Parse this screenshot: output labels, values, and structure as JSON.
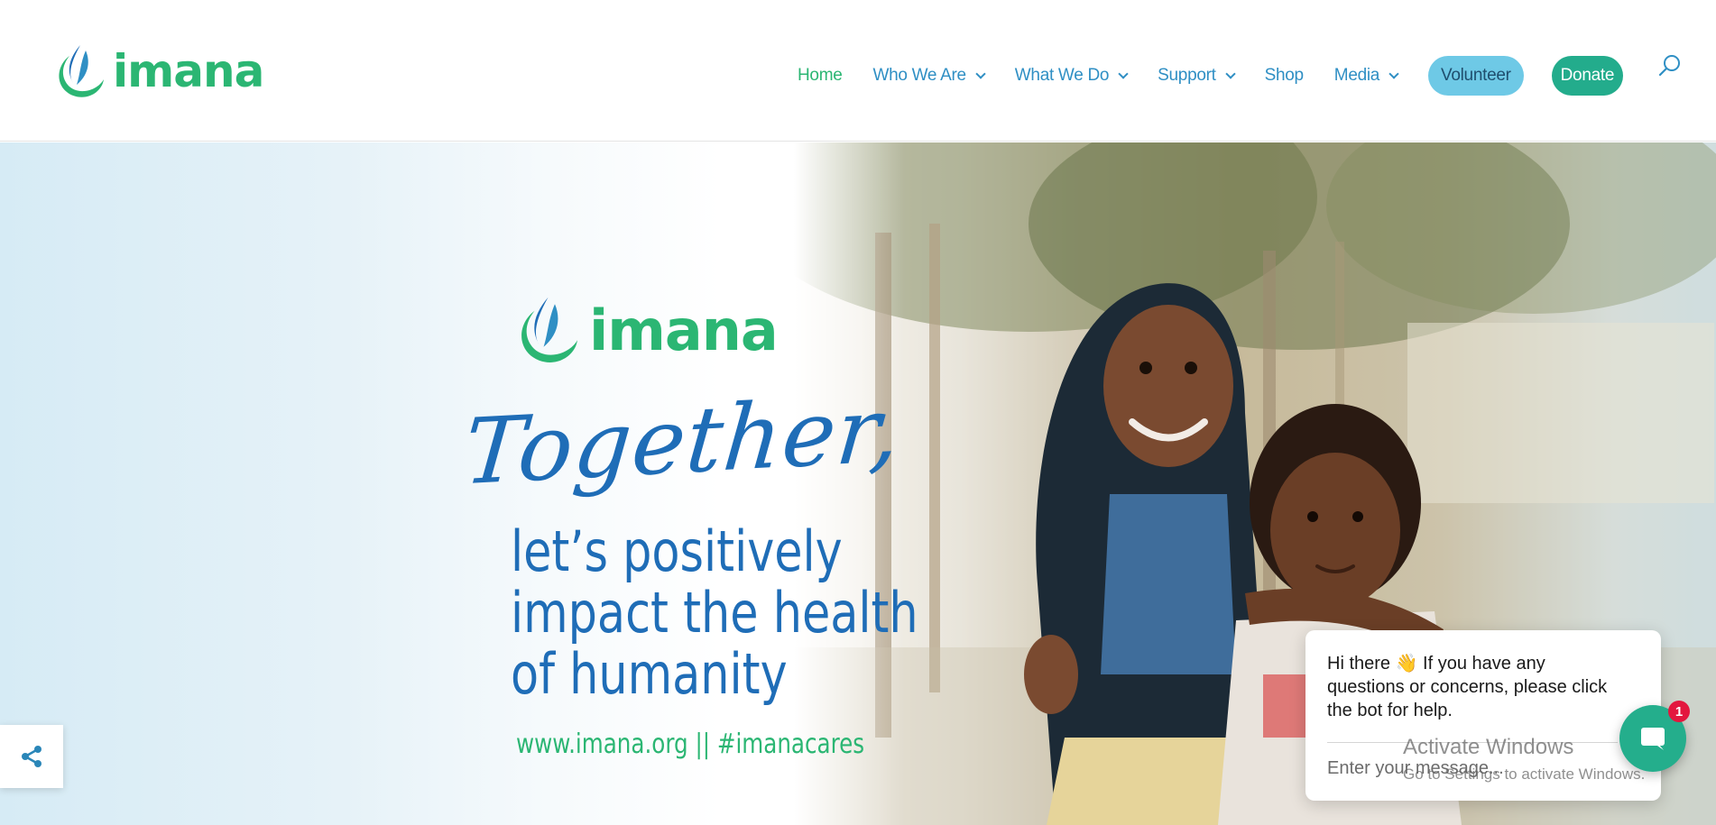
{
  "brand": {
    "name": "imana",
    "primary_green": "#2bb673",
    "primary_blue": "#1f6db7",
    "nav_blue": "#2f8fc4"
  },
  "nav": {
    "items": [
      {
        "label": "Home",
        "dropdown": false,
        "active": true
      },
      {
        "label": "Who We Are",
        "dropdown": true,
        "active": false
      },
      {
        "label": "What We Do",
        "dropdown": true,
        "active": false
      },
      {
        "label": "Support",
        "dropdown": true,
        "active": false
      },
      {
        "label": "Shop",
        "dropdown": false,
        "active": false
      },
      {
        "label": "Media",
        "dropdown": true,
        "active": false
      }
    ],
    "volunteer_label": "Volunteer",
    "donate_label": "Donate",
    "search_icon": "search-icon"
  },
  "hero": {
    "logo_text": "imana",
    "headline": "Together,",
    "tagline_lines": [
      "let’s positively",
      "impact the health",
      "of humanity"
    ],
    "url_text": "www.imana.org || #imanacares"
  },
  "share": {
    "icon": "share-icon"
  },
  "chat": {
    "message": "Hi there 👋 If you have any questions or concerns, please click the bot for help.",
    "input_placeholder": "Enter your message...",
    "badge_count": "1",
    "launcher_icon": "chat-bubble-icon",
    "launcher_color": "#24ae8c",
    "badge_color": "#e3173e"
  },
  "watermark": {
    "title": "Activate Windows",
    "subtitle": "Go to Settings to activate Windows."
  }
}
